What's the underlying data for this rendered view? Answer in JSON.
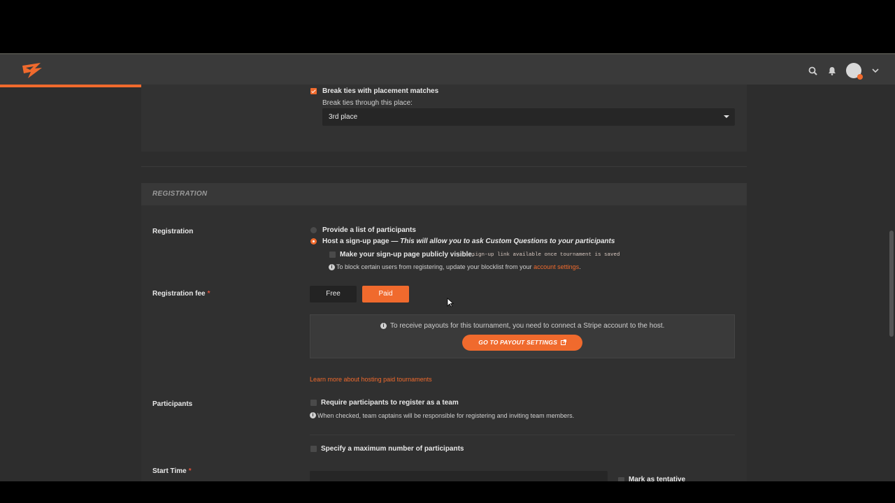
{
  "topbar": {
    "logo": "challonge-logo",
    "icons": [
      "search-icon",
      "bell-icon",
      "avatar",
      "chevron-down-icon"
    ],
    "accent_color": "#f06a2d"
  },
  "placement": {
    "break_ties_label": "Break ties with placement matches",
    "break_ties_checked": true,
    "through_label": "Break ties through this place:",
    "through_value": "3rd place"
  },
  "registration_section": {
    "title": "REGISTRATION",
    "registration_label": "Registration",
    "option_list": "Provide a list of participants",
    "option_signup_prefix": "Host a sign-up page —",
    "option_signup_note": "This will allow you to ask Custom Questions to your participants",
    "public_visible_label": "Make your sign-up page publicly visible.",
    "public_visible_note": "sign-up link available once tournament is saved",
    "blocklist_text": "To block certain users from registering, update your blocklist from your",
    "blocklist_link": "account settings",
    "blocklist_period": ".",
    "fee_label": "Registration fee",
    "required_mark": "*",
    "fee_free": "Free",
    "fee_paid": "Paid",
    "stripe_text": "To receive payouts for this tournament, you need to connect a Stripe account to the host.",
    "payout_button": "GO TO PAYOUT SETTINGS",
    "learn_more": "Learn more about hosting paid tournaments",
    "participants_label": "Participants",
    "team_label": "Require participants to register as a team",
    "team_help": "When checked, team captains will be responsible for registering and inviting team members.",
    "max_label": "Specify a maximum number of participants",
    "start_label": "Start Time",
    "tentative_label": "Mark as tentative"
  }
}
